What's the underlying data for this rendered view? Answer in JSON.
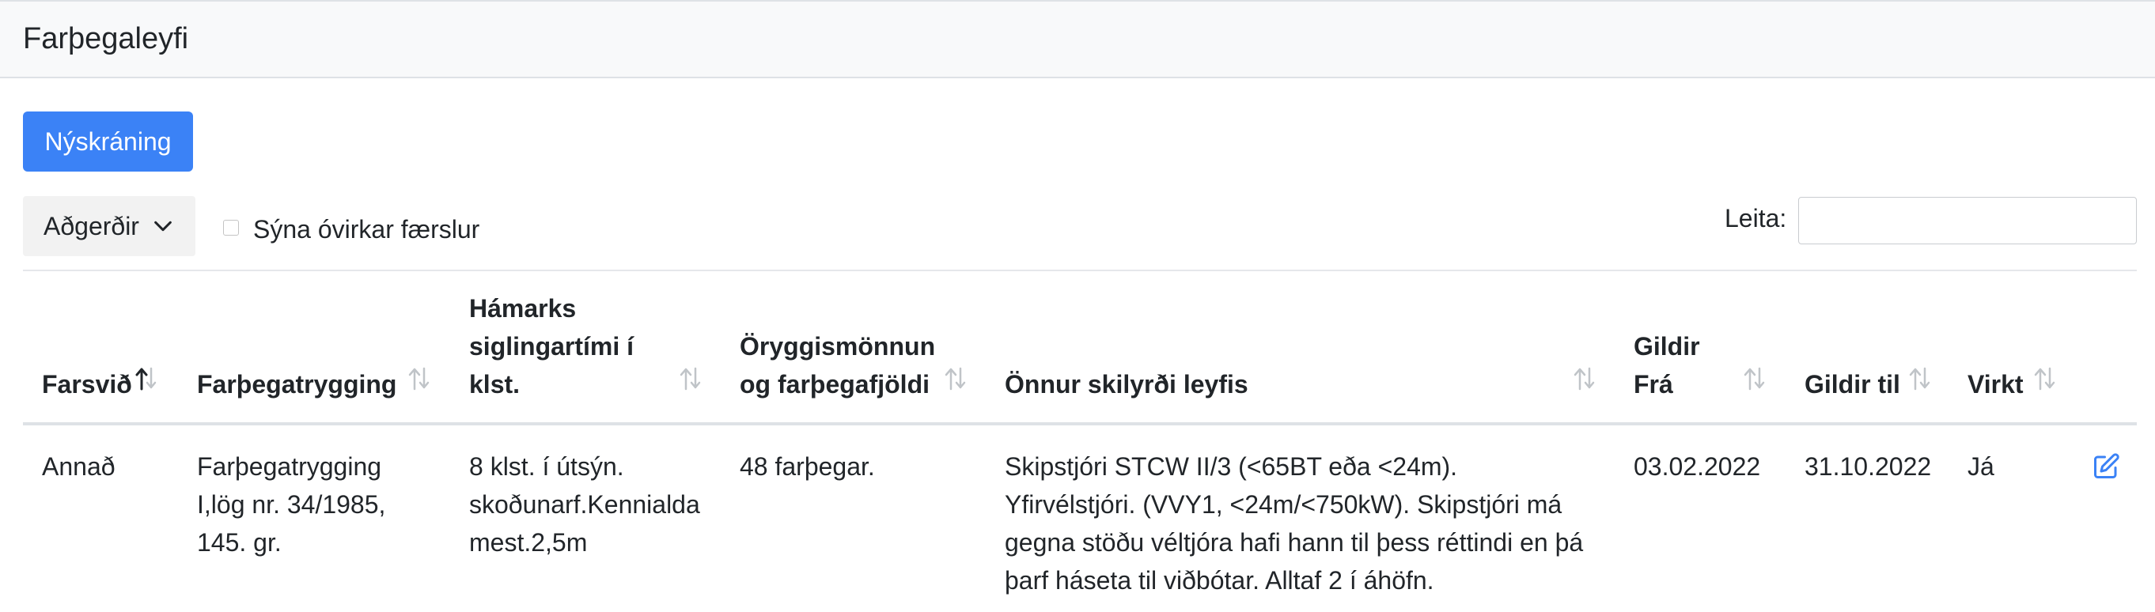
{
  "header": {
    "title": "Farþegaleyfi"
  },
  "toolbar": {
    "new_label": "Nýskráning",
    "actions_label": "Aðgerðir",
    "show_inactive_label": "Sýna óvirkar færslur",
    "show_inactive_checked": false,
    "search_label": "Leita:",
    "search_value": ""
  },
  "table": {
    "columns": [
      {
        "line1": "Farsvið",
        "line2": "",
        "line3": "",
        "sort": "asc"
      },
      {
        "line1": "Farþegatrygging",
        "line2": "",
        "line3": "",
        "sort": "none"
      },
      {
        "line1": "Hámarks",
        "line2": "siglingartími í",
        "line3": "klst.",
        "sort": "none"
      },
      {
        "line1": "Öryggismönnun",
        "line2": "og farþegafjöldi",
        "line3": "",
        "sort": "none"
      },
      {
        "line1": "Önnur skilyrði leyfis",
        "line2": "",
        "line3": "",
        "sort": "none"
      },
      {
        "line1": "Gildir",
        "line2": "Frá",
        "line3": "",
        "sort": "none"
      },
      {
        "line1": "Gildir til",
        "line2": "",
        "line3": "",
        "sort": "none"
      },
      {
        "line1": "Virkt",
        "line2": "",
        "line3": "",
        "sort": "none"
      }
    ],
    "rows": [
      {
        "farsvid": "Annað",
        "trygging": [
          "Farþegatrygging",
          "I,lög nr. 34/1985,",
          "145. gr."
        ],
        "timi": [
          "8 klst. í útsýn.",
          "skoðunarf.Kennialda",
          "mest.2,5m"
        ],
        "oryggi": "48 farþegar.",
        "skilyrdi": [
          "Skipstjóri STCW II/3 (<65BT eða <24m).",
          "Yfirvélstjóri. (VVY1, <24m/<750kW). Skipstjóri má",
          "gegna stöðu véltjóra hafi hann til þess réttindi en þá",
          "þarf háseta til viðbótar. Alltaf 2 í áhöfn."
        ],
        "fra": "03.02.2022",
        "til": "31.10.2022",
        "virkt": "Já",
        "edit_icon": "edit-icon"
      }
    ]
  },
  "colors": {
    "primary": "#3b82f6",
    "header_bg": "#f8f9fa",
    "sort_icon": "#c0c4c8"
  }
}
